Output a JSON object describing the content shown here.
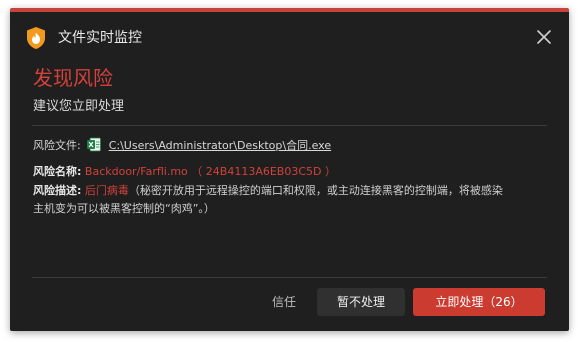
{
  "window": {
    "title": "文件实时监控",
    "app_icon": "flame-shield-icon",
    "close_icon": "close-icon"
  },
  "alert": {
    "heading": "发现风险",
    "subheading": "建议您立即处理"
  },
  "details": {
    "file_label": "风险文件:",
    "file_icon": "excel-file-icon",
    "file_path": "C:\\Users\\Administrator\\Desktop\\合同.exe",
    "name_label": "风险名称:",
    "name_value": "Backdoor/Farfli.mo",
    "name_hash": "（ 24B4113A6EB03C5D ）",
    "desc_label": "风险描述:",
    "desc_type": "后门病毒",
    "desc_text_line1": "（秘密开放用于远程操控的端口和权限，或主动连接黑客的控制端，将被感染",
    "desc_text_line2": "主机变为可以被黑客控制的“肉鸡”。）"
  },
  "actions": {
    "trust_label": "信任",
    "defer_label": "暂不处理",
    "handle_label": "立即处理（26）"
  },
  "colors": {
    "accent_red": "#d2413a",
    "background": "#1f1f1f",
    "primary_button": "#cc3b30",
    "excel_green": "#1e7e45"
  }
}
